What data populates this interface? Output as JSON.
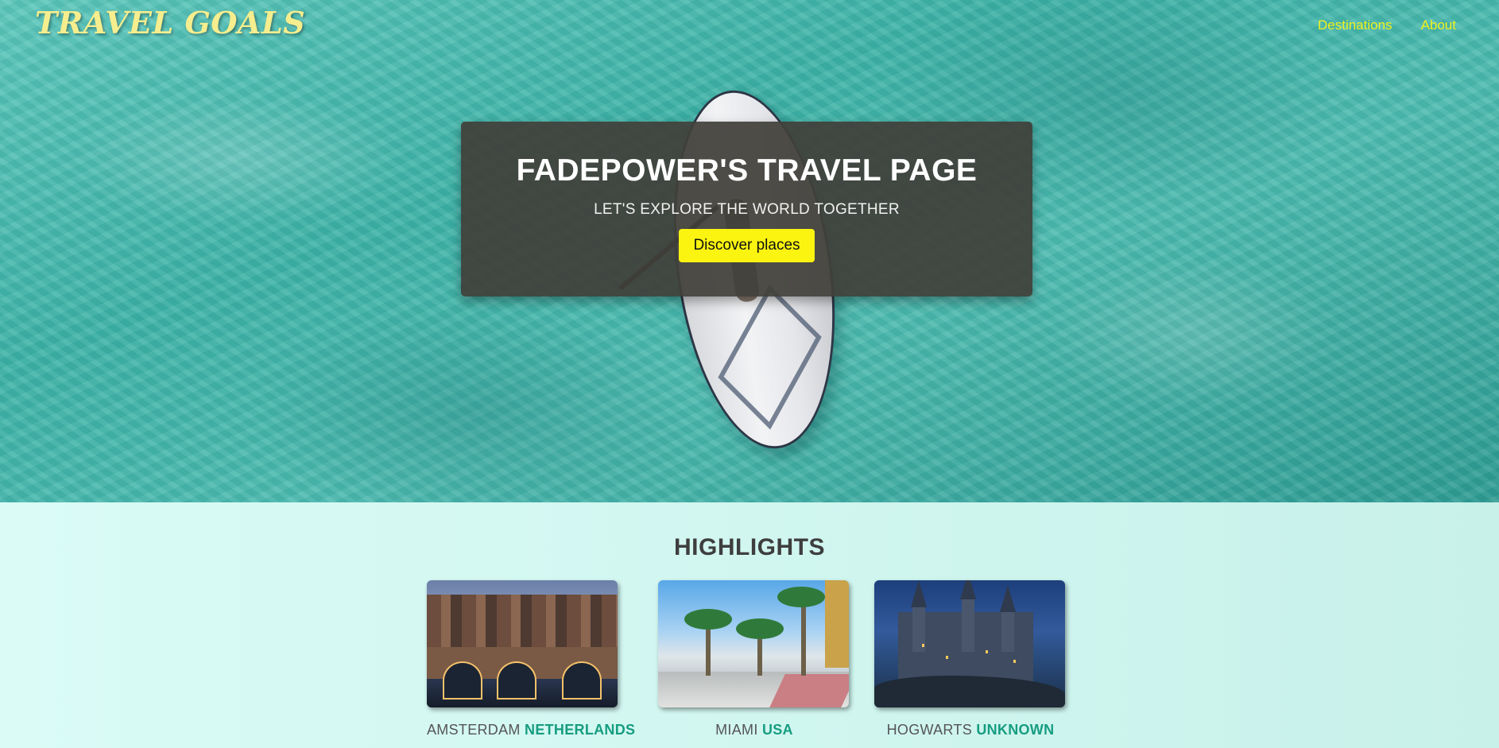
{
  "header": {
    "logo": "TRAVEL GOALS",
    "nav": [
      {
        "label": "Destinations"
      },
      {
        "label": "About"
      }
    ]
  },
  "hero": {
    "title": "FADEPOWER'S TRAVEL PAGE",
    "subtitle": "LET'S EXPLORE THE WORLD TOGETHER",
    "cta_label": "Discover places"
  },
  "highlights": {
    "title": "HIGHLIGHTS",
    "cards": [
      {
        "city": "AMSTERDAM",
        "country": "NETHERLANDS"
      },
      {
        "city": "MIAMI",
        "country": "USA"
      },
      {
        "city": "HOGWARTS",
        "country": "UNKNOWN"
      }
    ]
  },
  "colors": {
    "logo": "#f6ee8e",
    "nav_link": "#f1f21e",
    "cta_background": "#fbf410",
    "country_accent": "#169d80",
    "hero_card": "#413f3a"
  }
}
